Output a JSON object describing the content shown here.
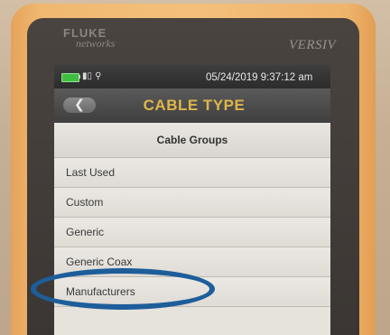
{
  "device": {
    "brand_top": "FLUKE",
    "brand_bottom": "networks",
    "model": "VERSIV"
  },
  "status": {
    "battery_icon": "battery-icon",
    "icons_text": "▮▯ ⚲",
    "datetime": "05/24/2019  9:37:12 am"
  },
  "header": {
    "back_symbol": "❮",
    "title": "CABLE TYPE"
  },
  "list": {
    "group_title": "Cable Groups",
    "items": [
      {
        "label": "Last Used"
      },
      {
        "label": "Custom"
      },
      {
        "label": "Generic"
      },
      {
        "label": "Generic Coax"
      },
      {
        "label": "Manufacturers"
      }
    ]
  },
  "annotation": {
    "color": "#1d5e9a"
  }
}
